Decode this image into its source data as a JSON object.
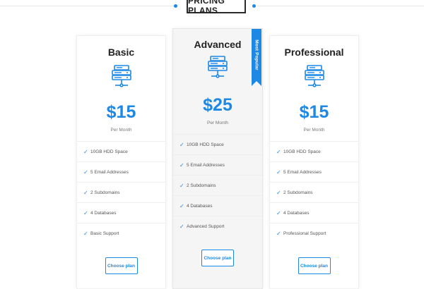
{
  "section_title": "PRICING PLANS",
  "colors": {
    "accent": "#1e88e5",
    "featured_bg": "#f5f5f5"
  },
  "plans": [
    {
      "name": "Basic",
      "icon": "server-icon",
      "price": "$15",
      "period": "Per Month",
      "features": [
        "10GB HDD Space",
        "5 Email Addresses",
        "2 Subdomains",
        "4 Databases",
        "Basic Support"
      ],
      "button_label": "Choose plan"
    },
    {
      "name": "Advanced",
      "icon": "server-icon",
      "badge": "Most Popular",
      "price": "$25",
      "period": "Per Month",
      "features": [
        "10GB HDD Space",
        "5 Email Addresses",
        "2 Subdomains",
        "4 Databases",
        "Advanced Support"
      ],
      "button_label": "Choose plan"
    },
    {
      "name": "Professional",
      "icon": "server-icon",
      "price": "$15",
      "period": "Per Month",
      "features": [
        "10GB HDD Space",
        "5 Email Addresses",
        "2 Subdomains",
        "4 Databases",
        "Professional Support"
      ],
      "button_label": "Choose plan"
    }
  ]
}
